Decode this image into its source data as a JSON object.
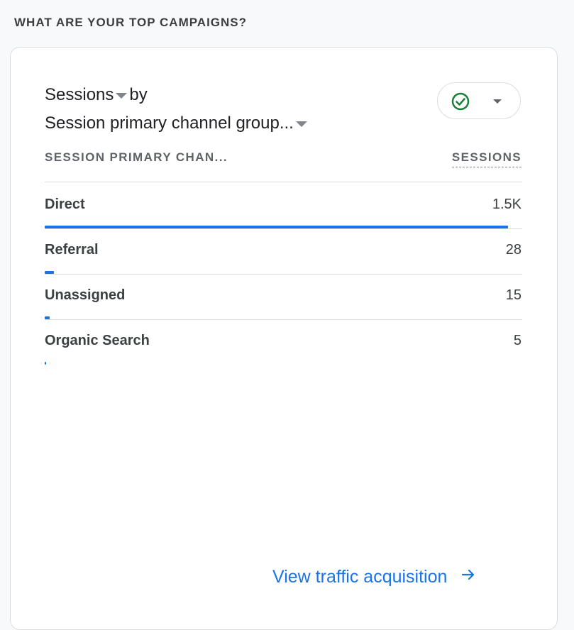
{
  "section": {
    "title": "WHAT ARE YOUR TOP CAMPAIGNS?"
  },
  "card": {
    "metric_label": "Sessions",
    "by_label": "by",
    "dimension_label": "Session primary channel group...",
    "status_icon": "check-circle-icon",
    "columns": {
      "dimension": "SESSION PRIMARY CHAN...",
      "metric": "SESSIONS"
    },
    "rows": [
      {
        "label": "Direct",
        "value": "1.5K",
        "share": 0.97
      },
      {
        "label": "Referral",
        "value": "28",
        "share": 0.019
      },
      {
        "label": "Unassigned",
        "value": "15",
        "share": 0.01
      },
      {
        "label": "Organic Search",
        "value": "5",
        "share": 0.003
      }
    ],
    "link_label": "View traffic acquisition"
  },
  "colors": {
    "accent": "#1a73e8",
    "success": "#188038"
  }
}
